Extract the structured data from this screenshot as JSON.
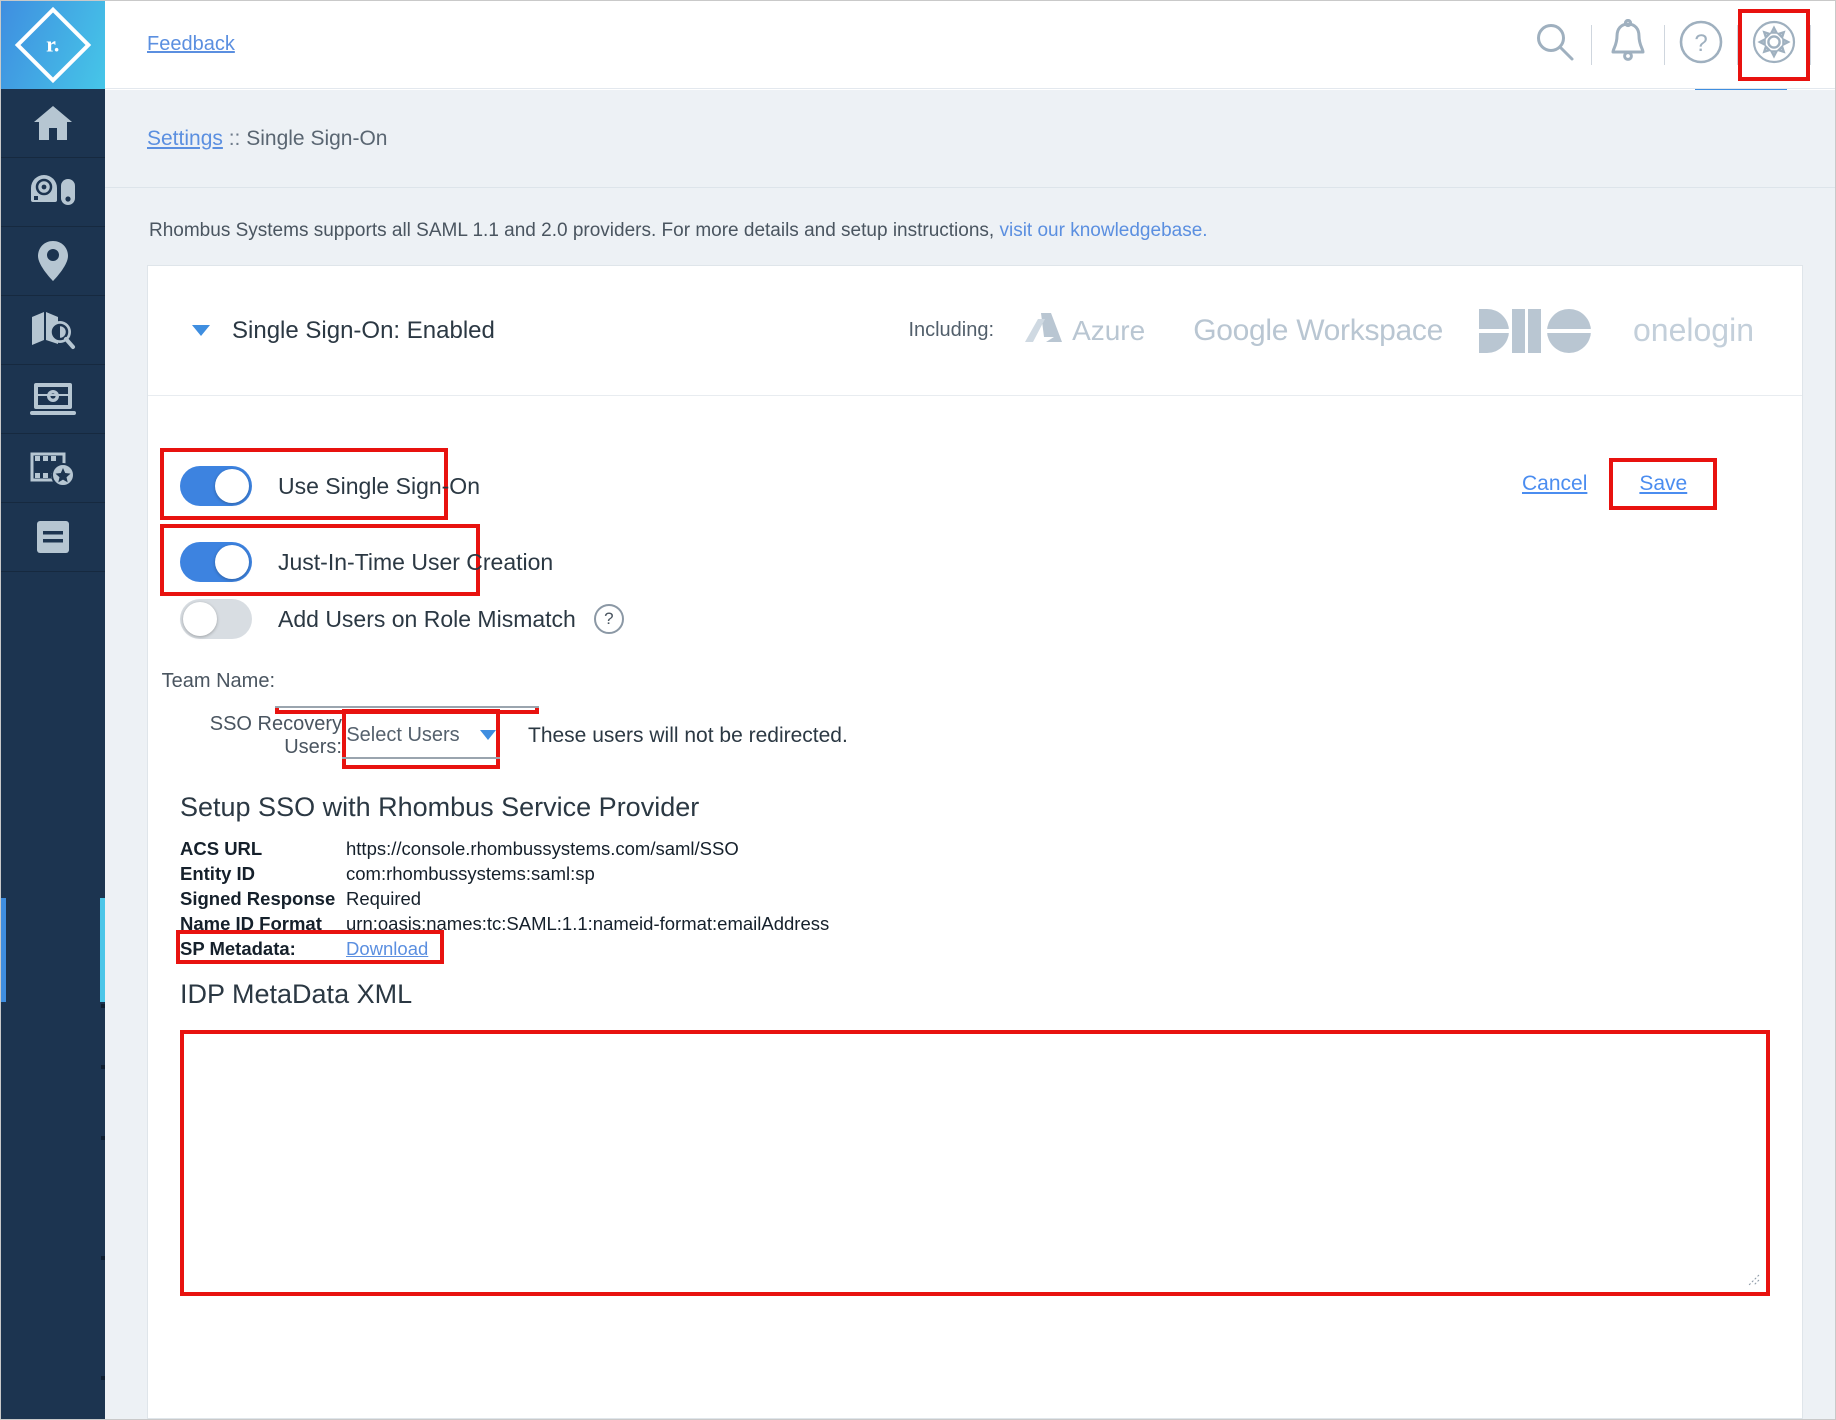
{
  "app": {
    "logo_text": "r.",
    "feedback_label": "Feedback"
  },
  "sidebar": {
    "items": [
      {
        "name": "home",
        "icon": "home-icon"
      },
      {
        "name": "cameras",
        "icon": "camera-device-icon"
      },
      {
        "name": "locations",
        "icon": "map-pin-icon"
      },
      {
        "name": "map-search",
        "icon": "map-search-icon"
      },
      {
        "name": "live-view",
        "icon": "monitor-view-icon"
      },
      {
        "name": "saved-clips",
        "icon": "film-star-icon"
      },
      {
        "name": "reports",
        "icon": "document-lines-icon"
      }
    ]
  },
  "topbar": {
    "icons": [
      {
        "name": "search-icon",
        "glyph": "search"
      },
      {
        "name": "notifications-bell-icon",
        "glyph": "bell"
      },
      {
        "name": "help-icon",
        "glyph": "question"
      },
      {
        "name": "settings-gear-icon",
        "glyph": "gear"
      }
    ]
  },
  "breadcrumb": {
    "root": "Settings",
    "separator": " :: ",
    "current": "Single Sign-On"
  },
  "intro": {
    "text": "Rhombus Systems supports all SAML 1.1 and 2.0 providers. For more details and setup instructions, ",
    "link": "visit our knowledgebase."
  },
  "sso_card": {
    "header_title": "Single Sign-On: Enabled",
    "including_label": "Including:",
    "providers": [
      {
        "name": "azure",
        "label": "Azure"
      },
      {
        "name": "google-workspace",
        "label": "Google Workspace"
      },
      {
        "name": "duo",
        "label": "DUO"
      },
      {
        "name": "onelogin",
        "label": "onelogin"
      }
    ],
    "toggles": [
      {
        "name": "use-single-sign-on",
        "label": "Use Single Sign-On",
        "state": "on"
      },
      {
        "name": "just-in-time-user-creation",
        "label": "Just-In-Time User Creation",
        "state": "on"
      },
      {
        "name": "add-users-on-role-mismatch",
        "label": "Add Users on Role Mismatch",
        "state": "off",
        "help": "?"
      }
    ],
    "cancel_label": "Cancel",
    "save_label": "Save",
    "team_name_label": "Team Name:",
    "team_name_value": "",
    "sso_recovery_label": "SSO Recovery Users:",
    "sso_recovery_select": "Select Users",
    "sso_recovery_hint": "These users will not be redirected.",
    "setup_title": "Setup SSO with Rhombus Service Provider",
    "sp_rows": [
      {
        "key": "ACS URL",
        "value": "https://console.rhombussystems.com/saml/SSO"
      },
      {
        "key": "Entity ID",
        "value": "com:rhombussystems:saml:sp"
      },
      {
        "key": "Signed Response",
        "value": "Required"
      },
      {
        "key": "Name ID Format",
        "value": "urn:oasis:names:tc:SAML:1.1:nameid-format:emailAddress"
      },
      {
        "key": "SP Metadata:",
        "value": "Download",
        "is_link": true
      }
    ],
    "idp_title": "IDP MetaData XML",
    "idp_value": ""
  },
  "colors": {
    "accent_blue": "#3d83e0",
    "link_blue": "#5b8fe0",
    "sidebar_navy": "#1c3450",
    "highlight_red": "#e8120f",
    "logo_cyan": "#46c6e8"
  }
}
